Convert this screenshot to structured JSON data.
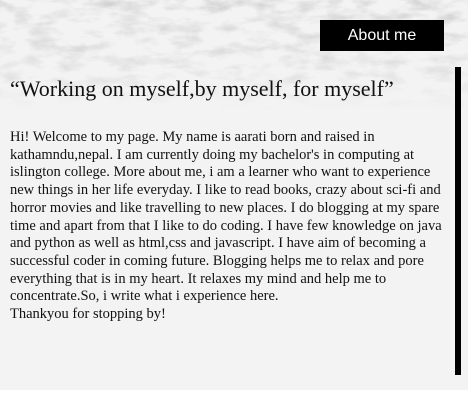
{
  "nav": {
    "about_label": "About me"
  },
  "quote": "“Working on myself,by myself, for myself”",
  "intro": {
    "body": "Hi! Welcome to my page. My name is aarati born and raised in kathamndu,nepal. I am currently doing my bachelor's in computing at islington college. More about me, i am a learner who want to experience new things in her life everyday. I like to read books, crazy about sci-fi and horror movies and like travelling to new places. I do blogging at my spare time and apart from that I like to do coding. I have few knowledge on java and python as well as html,css and javascript. I have aim of becoming a successful coder in coming future. Blogging helps me to relax and pore everything that is in my heart. It relaxes my mind and help me to concentrate.So, i write what i experience here.",
    "closing": "Thankyou for stopping by!"
  },
  "colors": {
    "background": "#f3f3f3",
    "button": "#000000",
    "button_text": "#ffffff",
    "text": "#111111"
  }
}
